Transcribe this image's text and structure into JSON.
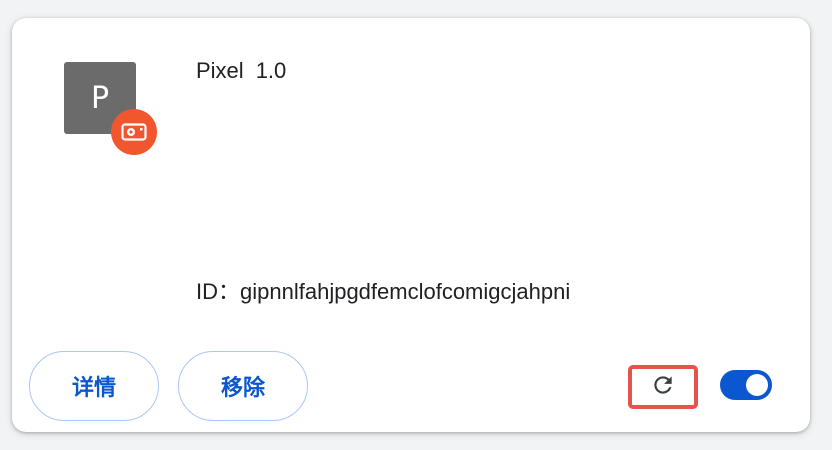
{
  "extension": {
    "icon_letter": "P",
    "name": "Pixel",
    "version": "1.0",
    "id_label": "ID：",
    "id_value": "gipnnlfahjpgdfemclofcomigcjahpni",
    "badge_icon": "camera-icon",
    "enabled": true
  },
  "actions": {
    "details_label": "详情",
    "remove_label": "移除",
    "reload_icon": "reload-icon"
  },
  "colors": {
    "icon_bg": "#6b6b6b",
    "badge": "#f1562e",
    "accent": "#0b57d0",
    "button_border": "#a8c7fa",
    "highlight": "#e5534b"
  }
}
